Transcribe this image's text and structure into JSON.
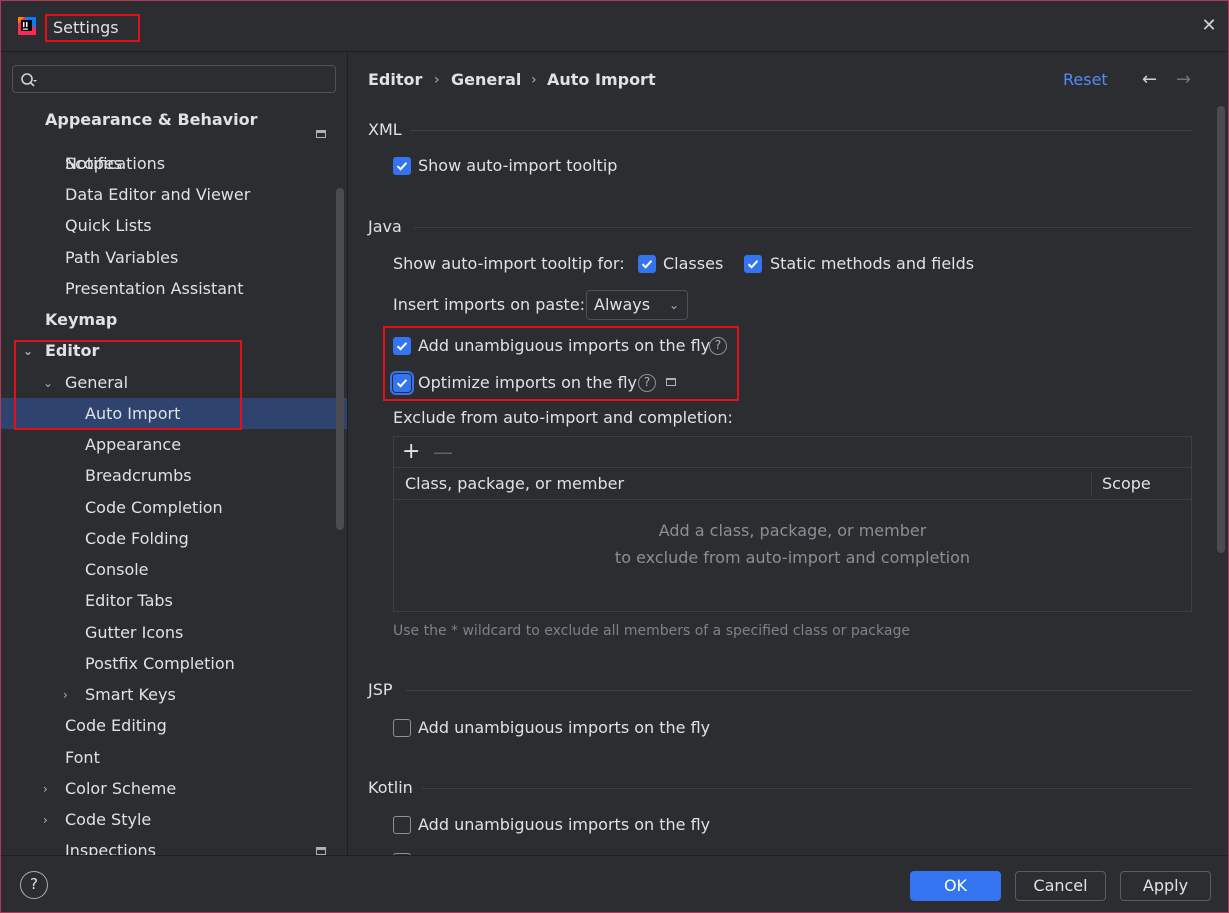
{
  "window": {
    "title": "Settings",
    "close_icon": "close-icon"
  },
  "sidebar": {
    "search": {
      "placeholder": ""
    },
    "items": [
      {
        "label": "Appearance & Behavior",
        "level": 0,
        "bold": true
      },
      {
        "label": "Scopes",
        "level": 1
      },
      {
        "label": "Notifications",
        "level": 1
      },
      {
        "label": "Data Editor and Viewer",
        "level": 1
      },
      {
        "label": "Quick Lists",
        "level": 1
      },
      {
        "label": "Path Variables",
        "level": 1
      },
      {
        "label": "Presentation Assistant",
        "level": 1
      },
      {
        "label": "Keymap",
        "level": 0,
        "bold": true
      },
      {
        "label": "Editor",
        "level": 0,
        "bold": true,
        "expanded": true
      },
      {
        "label": "General",
        "level": 1,
        "expanded": true
      },
      {
        "label": "Auto Import",
        "level": 2,
        "selected": true
      },
      {
        "label": "Appearance",
        "level": 2
      },
      {
        "label": "Breadcrumbs",
        "level": 2
      },
      {
        "label": "Code Completion",
        "level": 2
      },
      {
        "label": "Code Folding",
        "level": 2
      },
      {
        "label": "Console",
        "level": 2
      },
      {
        "label": "Editor Tabs",
        "level": 2
      },
      {
        "label": "Gutter Icons",
        "level": 2
      },
      {
        "label": "Postfix Completion",
        "level": 2
      },
      {
        "label": "Smart Keys",
        "level": 2,
        "collapsed": true
      },
      {
        "label": "Code Editing",
        "level": 1
      },
      {
        "label": "Font",
        "level": 1
      },
      {
        "label": "Color Scheme",
        "level": 1,
        "collapsed": true
      },
      {
        "label": "Code Style",
        "level": 1,
        "collapsed": true
      },
      {
        "label": "Inspections",
        "level": 1
      }
    ]
  },
  "header": {
    "breadcrumb": [
      "Editor",
      "General",
      "Auto Import"
    ],
    "reset_label": "Reset",
    "back_icon": "arrow-left-icon",
    "forward_icon": "arrow-right-icon"
  },
  "sections": {
    "xml": {
      "title": "XML",
      "show_tooltip": {
        "label": "Show auto-import tooltip",
        "checked": true
      }
    },
    "java": {
      "title": "Java",
      "tooltip_for_label": "Show auto-import tooltip for:",
      "classes": {
        "label": "Classes",
        "checked": true
      },
      "static_methods": {
        "label": "Static methods and fields",
        "checked": true
      },
      "insert_on_paste_label": "Insert imports on paste:",
      "insert_on_paste_value": "Always",
      "add_unambiguous": {
        "label": "Add unambiguous imports on the fly",
        "checked": true
      },
      "optimize": {
        "label": "Optimize imports on the fly",
        "checked": true
      },
      "exclude_label": "Exclude from auto-import and completion:",
      "table": {
        "columns": [
          "Class, package, or member",
          "Scope"
        ],
        "empty_line1": "Add a class, package, or member",
        "empty_line2": "to exclude from auto-import and completion"
      },
      "hint": "Use the * wildcard to exclude all members of a specified class or package"
    },
    "jsp": {
      "title": "JSP",
      "add_unambiguous": {
        "label": "Add unambiguous imports on the fly",
        "checked": false
      }
    },
    "kotlin": {
      "title": "Kotlin",
      "add_unambiguous": {
        "label": "Add unambiguous imports on the fly",
        "checked": false
      }
    }
  },
  "footer": {
    "ok": "OK",
    "cancel": "Cancel",
    "apply": "Apply",
    "help": "?"
  },
  "colors": {
    "accent": "#3574f0",
    "link": "#548af7",
    "selection": "#2e436e",
    "highlight_box": "#e3101a"
  }
}
